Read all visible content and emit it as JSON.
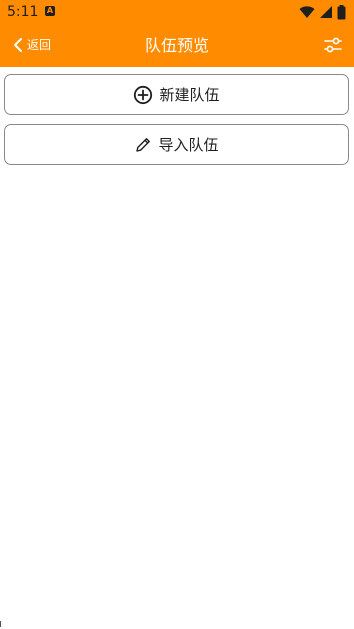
{
  "status_bar": {
    "time": "5:11",
    "notification_badge": "A",
    "icons": [
      "wifi-icon",
      "signal-icon",
      "battery-icon"
    ]
  },
  "app_bar": {
    "back_label": "返回",
    "title": "队伍预览",
    "filter_icon": "sliders-icon",
    "background": "#ff8c00"
  },
  "actions": [
    {
      "label": "新建队伍",
      "icon": "plus-circle-icon"
    },
    {
      "label": "导入队伍",
      "icon": "pencil-icon"
    }
  ]
}
